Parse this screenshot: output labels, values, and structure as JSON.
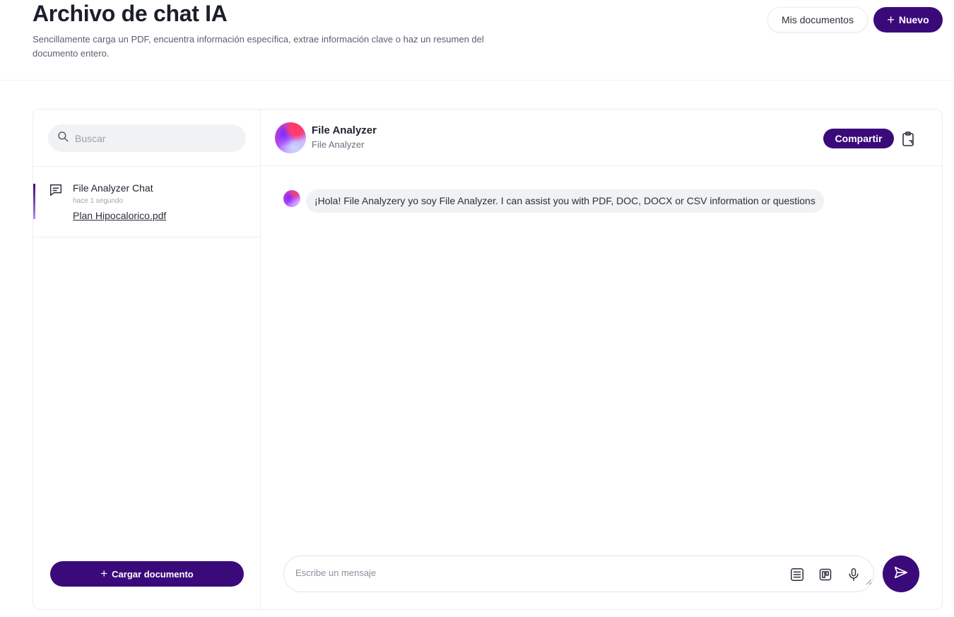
{
  "header": {
    "title": "Archivo de chat IA",
    "subtitle": "Sencillamente carga un PDF, encuentra información específica, extrae información clave o haz un resumen del documento entero.",
    "my_docs_label": "Mis documentos",
    "new_label": "Nuevo"
  },
  "sidebar": {
    "search_placeholder": "Buscar",
    "chats": [
      {
        "name": "File Analyzer Chat",
        "time": "hace 1 segundo",
        "file": "Plan Hipocalorico.pdf"
      }
    ],
    "upload_label": "Cargar documento"
  },
  "chat": {
    "agent_name": "File Analyzer",
    "agent_subtitle": "File Analyzer",
    "share_label": "Compartir",
    "messages": [
      {
        "from": "agent",
        "text": "¡Hola!  File Analyzery yo soy File Analyzer. I can assist you with PDF, DOC, DOCX or CSV information or questions"
      }
    ],
    "input_placeholder": "Escribe un mensaje"
  },
  "colors": {
    "brand": "#3b0a7a",
    "bubble_bg": "#f1f2f4",
    "border": "#eceef2"
  },
  "icons": [
    "plus-icon",
    "search-icon",
    "chat-bubble-icon",
    "clipboard-icon",
    "list-icon",
    "board-icon",
    "microphone-icon",
    "send-icon"
  ]
}
